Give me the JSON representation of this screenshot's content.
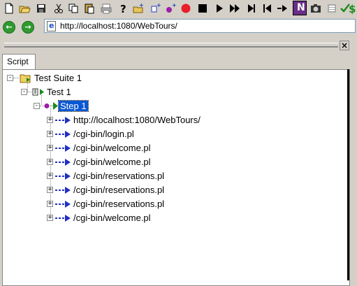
{
  "toolbar": {
    "buttons": [
      {
        "name": "new-icon"
      },
      {
        "name": "open-icon"
      },
      {
        "name": "save-icon"
      },
      {
        "name": "cut-icon"
      },
      {
        "name": "copy-icon"
      },
      {
        "name": "paste-icon"
      },
      {
        "name": "print-icon"
      },
      {
        "name": "help-icon"
      },
      {
        "name": "add-folder-icon"
      },
      {
        "name": "add-step-icon"
      },
      {
        "name": "add-node-icon"
      },
      {
        "name": "record-icon"
      },
      {
        "name": "stop-icon"
      },
      {
        "name": "play-icon"
      },
      {
        "name": "fast-forward-icon"
      },
      {
        "name": "step-icon"
      },
      {
        "name": "skip-back-icon"
      },
      {
        "name": "forward-icon"
      },
      {
        "name": "n-icon"
      },
      {
        "name": "camera-icon"
      },
      {
        "name": "list-icon"
      },
      {
        "name": "check-icon"
      },
      {
        "name": "dollar-icon"
      }
    ],
    "n_label": "N"
  },
  "address": {
    "url": "http://localhost:1080/WebTours/"
  },
  "tab": {
    "label": "Script"
  },
  "tree": {
    "suite": "Test Suite 1",
    "test": "Test 1",
    "step": "Step 1",
    "requests": [
      "http://localhost:1080/WebTours/",
      "/cgi-bin/login.pl",
      "/cgi-bin/welcome.pl",
      "/cgi-bin/welcome.pl",
      "/cgi-bin/reservations.pl",
      "/cgi-bin/reservations.pl",
      "/cgi-bin/reservations.pl",
      "/cgi-bin/welcome.pl"
    ]
  },
  "close_label": "×"
}
